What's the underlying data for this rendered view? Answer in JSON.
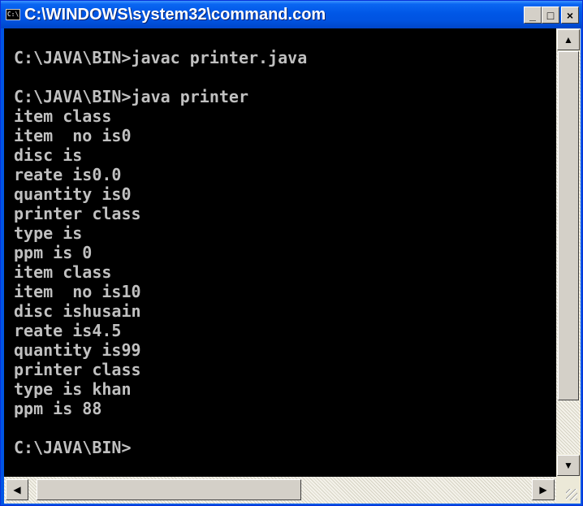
{
  "window": {
    "title": "C:\\WINDOWS\\system32\\command.com",
    "icon_name": "ms-dos-icon",
    "controls": {
      "minimize": "_",
      "maximize": "□",
      "close": "×"
    }
  },
  "console": {
    "lines": [
      "",
      "C:\\JAVA\\BIN>javac printer.java",
      "",
      "C:\\JAVA\\BIN>java printer",
      "item class",
      "item  no is0",
      "disc is",
      "reate is0.0",
      "quantity is0",
      "printer class",
      "type is",
      "ppm is 0",
      "item class",
      "item  no is10",
      "disc ishusain",
      "reate is4.5",
      "quantity is99",
      "printer class",
      "type is khan",
      "ppm is 88",
      "",
      "C:\\JAVA\\BIN>"
    ],
    "colors": {
      "background": "#000000",
      "text": "#c0c0c0"
    }
  },
  "scrollbars": {
    "up_arrow": "▲",
    "down_arrow": "▼",
    "left_arrow": "◀",
    "right_arrow": "▶"
  }
}
